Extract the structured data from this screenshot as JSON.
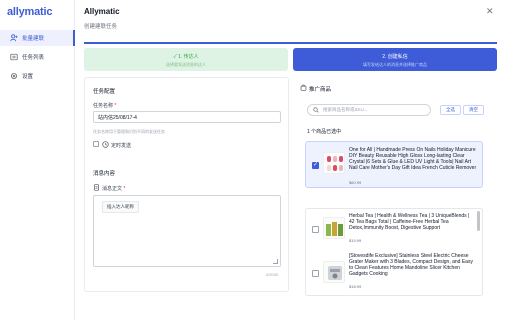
{
  "app": {
    "logo": "allymatic"
  },
  "sidebar": {
    "items": [
      {
        "label": "批量建联",
        "icon": "user-plus-icon",
        "active": true
      },
      {
        "label": "任务列表",
        "icon": "list-icon",
        "active": false
      },
      {
        "label": "设置",
        "icon": "gear-icon",
        "active": false
      }
    ]
  },
  "header": {
    "title": "Allymatic",
    "subtitle": "创建建联任务"
  },
  "steps": [
    {
      "title": "✓  1. 传达人",
      "sub": "选择要发送消息的达人"
    },
    {
      "title": "2. 创建私信",
      "sub": "填写发给达人的消息并选择推广商品"
    }
  ],
  "task_config": {
    "title": "任务配置",
    "name_label": "任务名称",
    "name_value": "站内信25/08/17-4",
    "name_hint": "任务名称用于管理和识别不同的发送任务",
    "schedule_label": "定时发送"
  },
  "message": {
    "title": "消息内容",
    "body_label": "消息正文",
    "insert_button": "插入达人昵称",
    "counter": "0/2000"
  },
  "promo": {
    "title": "推广商品",
    "search_placeholder": "搜索商品名称或SKU...",
    "select_all": "全选",
    "clear": "清空",
    "selected_count": "1 个商品已选中",
    "selected_product": {
      "title": "One for All | Handmade Press On Nails Holiday Manicure DIY Beauty Reusable High Gloss Long-lasting Clear Crystal |6 Sets & Glue & LED UV Light & Tools| Nail Art Nail Care Mother's Day Gift Idea French Cuticle Remover",
      "price": "$60.99"
    },
    "products": [
      {
        "title": "Herbal Tea | Health & Wellness Tea | 3 UniqueBlends | 42 Tea Bags Total | Caffeine-Free Herbal Tea Detox,Immunity Boost, Digestive Support",
        "price": "$19.99"
      },
      {
        "title": "[Stovesdife Exclusive] Stainless Steel Electric Cheese Grater Maker with 3 Blades, Compact Design, and Easy to Clean Features Home Mandoline Slicer Kitchen Gadgets Cooking",
        "price": "$18.99"
      }
    ]
  }
}
